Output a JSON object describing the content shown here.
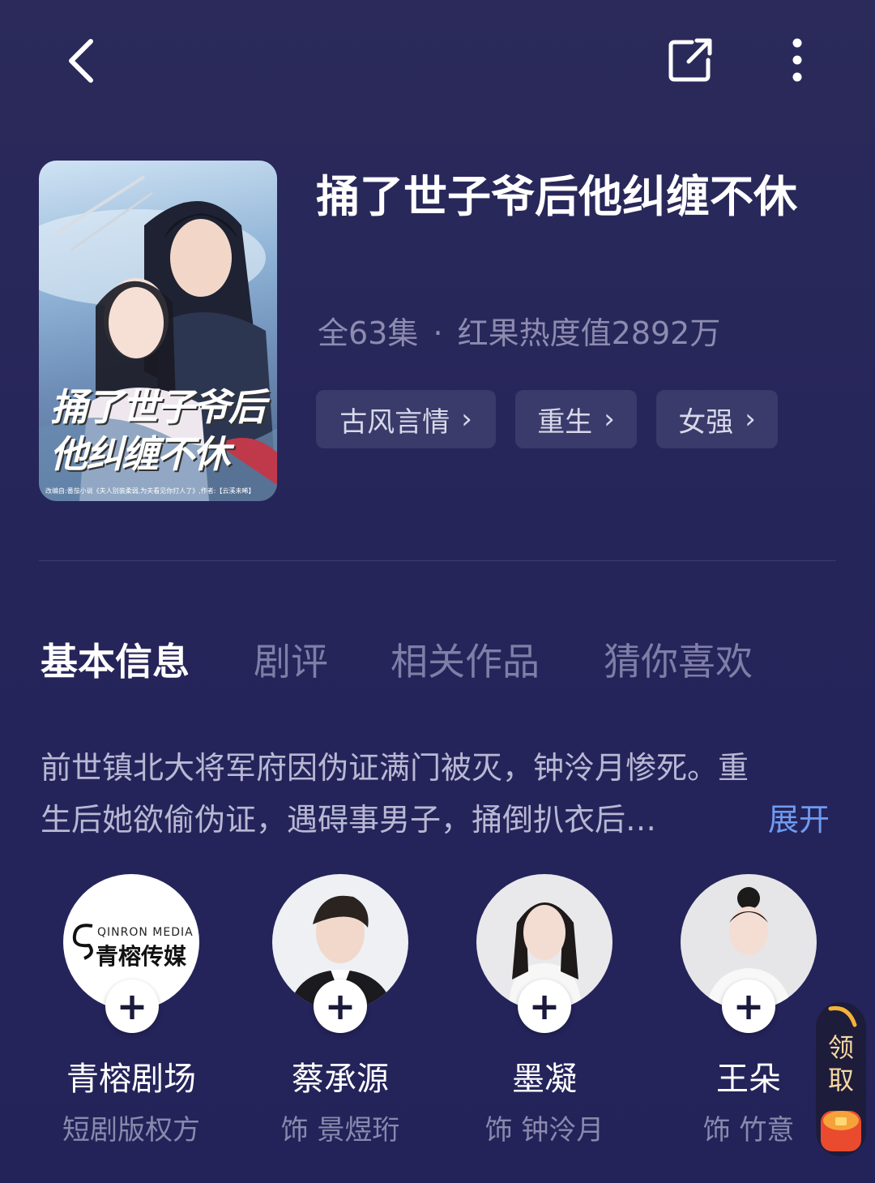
{
  "header": {
    "back_icon": "chevron-left-icon",
    "share_icon": "share-icon",
    "more_icon": "more-vertical-icon"
  },
  "poster": {
    "line1": "捅了世子爷后",
    "line2": "他纠缠不休",
    "credit": "改编自:番茄小说《夫人别装柔弱,为夫看见你打人了》,作者:【云溪未晞】"
  },
  "drama": {
    "title": "捅了世子爷后他纠缠不休",
    "episodes": "全63集",
    "heat": "红果热度值2892万",
    "tags": [
      "古风言情",
      "重生",
      "女强"
    ]
  },
  "tabs": [
    "基本信息",
    "剧评",
    "相关作品",
    "猜你喜欢"
  ],
  "description": {
    "line1": "前世镇北大将军府因伪证满门被灭，钟泠月惨死。重",
    "line2": "生后她欲偷伪证，遇碍事男子，捅倒扒衣后…",
    "expand": "展开"
  },
  "cast": [
    {
      "name": "青榕剧场",
      "role": "短剧版权方",
      "logo_en": "QINRON MEDIA",
      "logo_cn": "青榕传媒"
    },
    {
      "name": "蔡承源",
      "role": "饰 景煜珩"
    },
    {
      "name": "墨凝",
      "role": "饰 钟泠月"
    },
    {
      "name": "王朵",
      "role": "饰 竹意"
    }
  ],
  "reward": {
    "label": "领取"
  },
  "colors": {
    "bg": "#26255a",
    "accent_link": "#6f9bf2",
    "tag_bg": "#3a3a6b"
  }
}
